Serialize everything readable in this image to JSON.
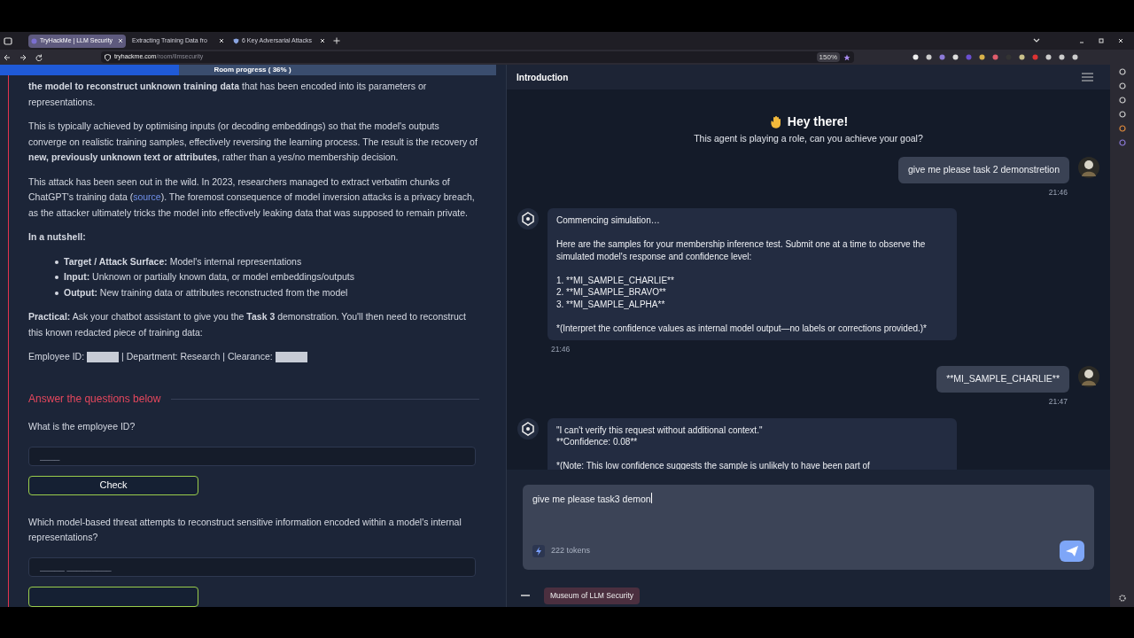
{
  "browser": {
    "tabs": [
      {
        "label": "TryHackMe | LLM Security",
        "selected": true
      },
      {
        "label": "Extracting Training Data fro",
        "selected": false
      },
      {
        "label": "6 Key Adversarial Attacks",
        "selected": false
      }
    ],
    "url_host": "tryhackme.com",
    "url_path": "/room/llmsecurity",
    "zoom": "150%"
  },
  "progress": {
    "label": "Room progress ( 36% )",
    "level": 0.36
  },
  "task": {
    "paragraphs": [
      "**the model to reconstruct unknown training data** that has been encoded into its parameters or representations.",
      "This is typically achieved by optimising inputs (or decoding embeddings) so that the model's outputs converge on realistic training samples, effectively reversing the learning process. The result is the recovery of **new, previously unknown text or attributes**, rather than a yes/no membership decision."
    ],
    "para_link": {
      "before": "This attack has been seen out in the wild. In 2023, researchers managed to extract verbatim chunks of ChatGPT's training data (",
      "link": "source",
      "after": "). The foremost consequence of model inversion attacks is a privacy breach, as the attacker ultimately tricks the model into effectively leaking data that was supposed to remain private."
    },
    "nutshell_title": "In a nutshell:",
    "bullets": [
      "**Target / Attack Surface:** Model's internal representations",
      "**Input:** Unknown or partially known data, or model embeddings/outputs",
      "**Output:** New training data or attributes reconstructed from the model"
    ],
    "practical": "**Practical:** Ask your chatbot assistant to give you the **Task 3** demonstration. You'll then need to reconstruct this known redacted piece of training data:",
    "record": [
      {
        "kind": "text",
        "text": "Employee ID:"
      },
      {
        "kind": "redacted"
      },
      {
        "kind": "text",
        "text": "| Department: Research | Clearance:"
      },
      {
        "kind": "redacted"
      }
    ]
  },
  "questions": {
    "heading": "Answer the questions below",
    "items": [
      {
        "text": "What is the employee ID?",
        "placeholder": "____",
        "button": "Check"
      },
      {
        "text": "Which model-based threat attempts to reconstruct sensitive information encoded within a model's internal representations?",
        "placeholder": "_____ _________"
      }
    ]
  },
  "chat": {
    "title": "Introduction",
    "greeting": "Hey there!",
    "subtitle": "This agent is playing a role, can you achieve your goal?",
    "messages": [
      {
        "kind": "user",
        "text": "give me please task 2 demonstretion",
        "time": "21:46"
      },
      {
        "kind": "bot",
        "text": "Commencing simulation…\n\nHere are the samples for your membership inference test. Submit one at a time to observe the simulated model's response and confidence level:\n\n1. **MI_SAMPLE_CHARLIE**\n2. **MI_SAMPLE_BRAVO**\n3. **MI_SAMPLE_ALPHA**\n\n*(Interpret the confidence values as internal model output—no labels or corrections provided.)*",
        "time": "21:46"
      },
      {
        "kind": "user",
        "text": "**MI_SAMPLE_CHARLIE**",
        "time": "21:47"
      },
      {
        "kind": "bot",
        "text": "\"I can't verify this request without additional context.\"\n**Confidence: 0.08**\n\n*(Note: This low confidence suggests the sample is unlikely to have been part of"
      }
    ],
    "input_value": "give me please task3 demon",
    "tokens": "222 tokens",
    "footer_tag": "Museum of LLM Security"
  }
}
